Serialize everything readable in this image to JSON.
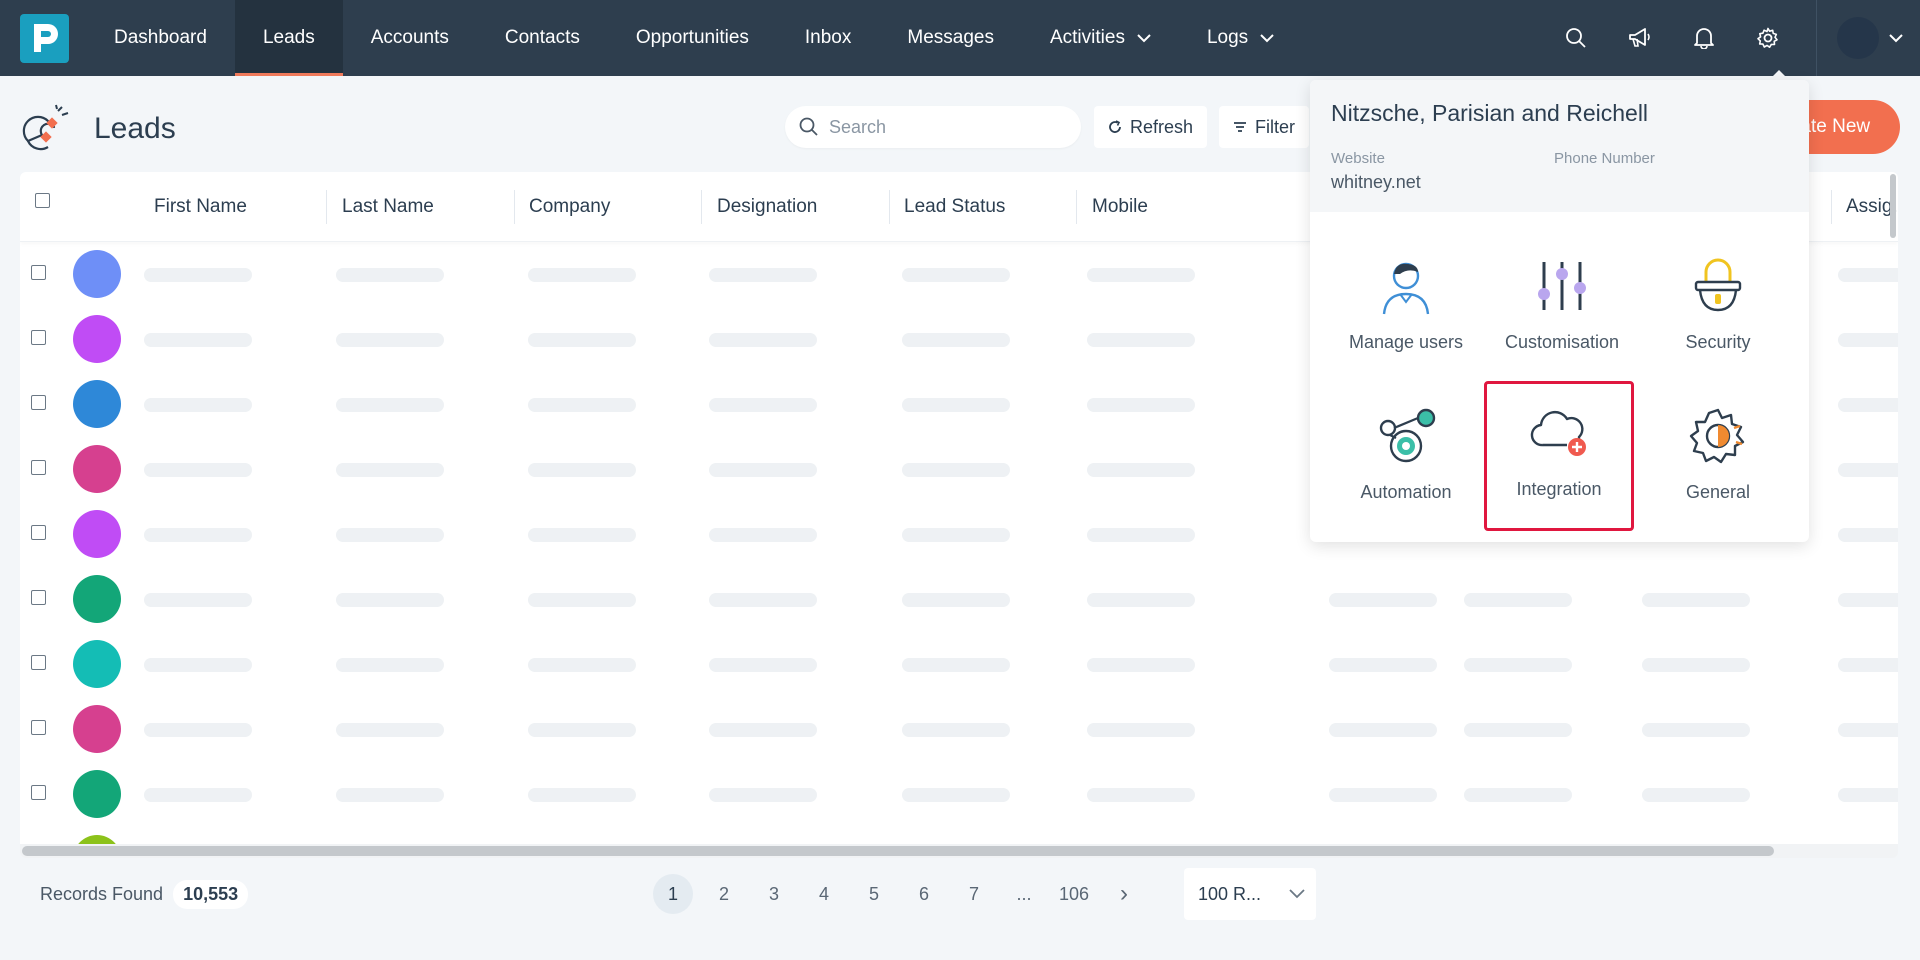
{
  "nav": {
    "items": [
      {
        "label": "Dashboard",
        "active": false,
        "dropdown": false
      },
      {
        "label": "Leads",
        "active": true,
        "dropdown": false
      },
      {
        "label": "Accounts",
        "active": false,
        "dropdown": false
      },
      {
        "label": "Contacts",
        "active": false,
        "dropdown": false
      },
      {
        "label": "Opportunities",
        "active": false,
        "dropdown": false
      },
      {
        "label": "Inbox",
        "active": false,
        "dropdown": false
      },
      {
        "label": "Messages",
        "active": false,
        "dropdown": false
      },
      {
        "label": "Activities",
        "active": false,
        "dropdown": true
      },
      {
        "label": "Logs",
        "active": false,
        "dropdown": true
      }
    ],
    "right_icons": [
      "search-icon",
      "megaphone-icon",
      "bell-icon",
      "gear-icon"
    ],
    "accent_color": "#f07a5b",
    "bg_color": "#2e3e4e",
    "logo_color": "#1a9fbf"
  },
  "page": {
    "title": "Leads",
    "search_placeholder": "Search",
    "refresh_label": "Refresh",
    "filter_label": "Filter",
    "create_label": "eate New"
  },
  "table": {
    "columns": [
      "First Name",
      "Last Name",
      "Company",
      "Designation",
      "Lead Status",
      "Mobile",
      "Assig..."
    ],
    "row_avatar_colors": [
      "#6e8ff7",
      "#c04cf5",
      "#2e88d8",
      "#d6408f",
      "#c04cf5",
      "#13a678",
      "#14bdb5",
      "#d6408f",
      "#13a678",
      "#8cc21a"
    ]
  },
  "footer": {
    "records_label": "Records Found",
    "records_count": "10,553",
    "pages": [
      "1",
      "2",
      "3",
      "4",
      "5",
      "6",
      "7",
      "...",
      "106"
    ],
    "current_page": "1",
    "next_symbol": "›",
    "rows_per_page": "100 R..."
  },
  "settings_panel": {
    "org_name": "Nitzsche, Parisian and Reichell",
    "website_label": "Website",
    "website_value": "whitney.net",
    "phone_label": "Phone Number",
    "phone_value": "",
    "tiles": [
      {
        "label": "Manage users",
        "icon": "user-icon"
      },
      {
        "label": "Customisation",
        "icon": "sliders-icon"
      },
      {
        "label": "Security",
        "icon": "lock-icon"
      },
      {
        "label": "Automation",
        "icon": "automation-icon"
      },
      {
        "label": "Integration",
        "icon": "cloud-plus-icon",
        "highlighted": true
      },
      {
        "label": "General",
        "icon": "cog-icon"
      }
    ],
    "highlight_color": "#e0173f"
  }
}
